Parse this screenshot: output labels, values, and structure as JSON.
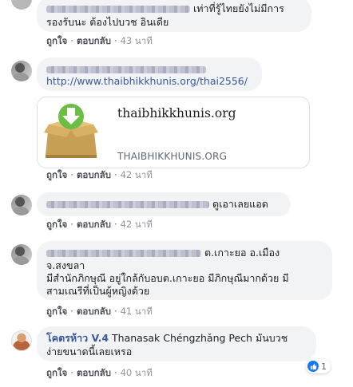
{
  "comments": [
    {
      "text_lines": [
        "เท่าที่รู้ไทยยังไม่มีการ",
        "รองรับนะ ต้องไปบวช อินเดีย"
      ],
      "like": "ถูกใจ",
      "reply": "ตอบกลับ",
      "time": "43 นาที"
    },
    {
      "link": "http://www.thaibhikkhunis.org/thai2556/",
      "preview": {
        "title": "thaibhikkhunis.org",
        "domain": "THAIBHIKKHUNIS.ORG",
        "thumb_icon": "download-box-icon"
      },
      "like": "ถูกใจ",
      "reply": "ตอบกลับ",
      "time": "42 นาที"
    },
    {
      "text": "ดูเอาเลยแอด",
      "like": "ถูกใจ",
      "reply": "ตอบกลับ",
      "time": "42 นาที"
    },
    {
      "text_lines": [
        "ต.เกาะยอ อ.เมือง",
        "จ.สงขลา",
        "มีสำนักภิกษุณี อยู่ใกล้กับอบต.เกาะยอ มีภิกษุณีมากด้วย มี",
        "สามเณรีที่เป็นผู้หญิงด้วย"
      ],
      "like": "ถูกใจ",
      "reply": "ตอบกลับ",
      "time": "41 นาที"
    },
    {
      "author": "โคตรห้าว V.4",
      "text_lines": [
        "Thanasak Chéngzhǎng Pech มันบวช",
        "ง่ายขนาดนี้เลยเหรอ"
      ],
      "like": "ถูกใจ",
      "reply": "ตอบกลับ",
      "time": "40 นาที",
      "reaction_count": "1"
    }
  ],
  "colors": {
    "bubble": "#f2f3f5",
    "link": "#385898",
    "like_blue": "#1877f2",
    "meta": "#90949c"
  }
}
